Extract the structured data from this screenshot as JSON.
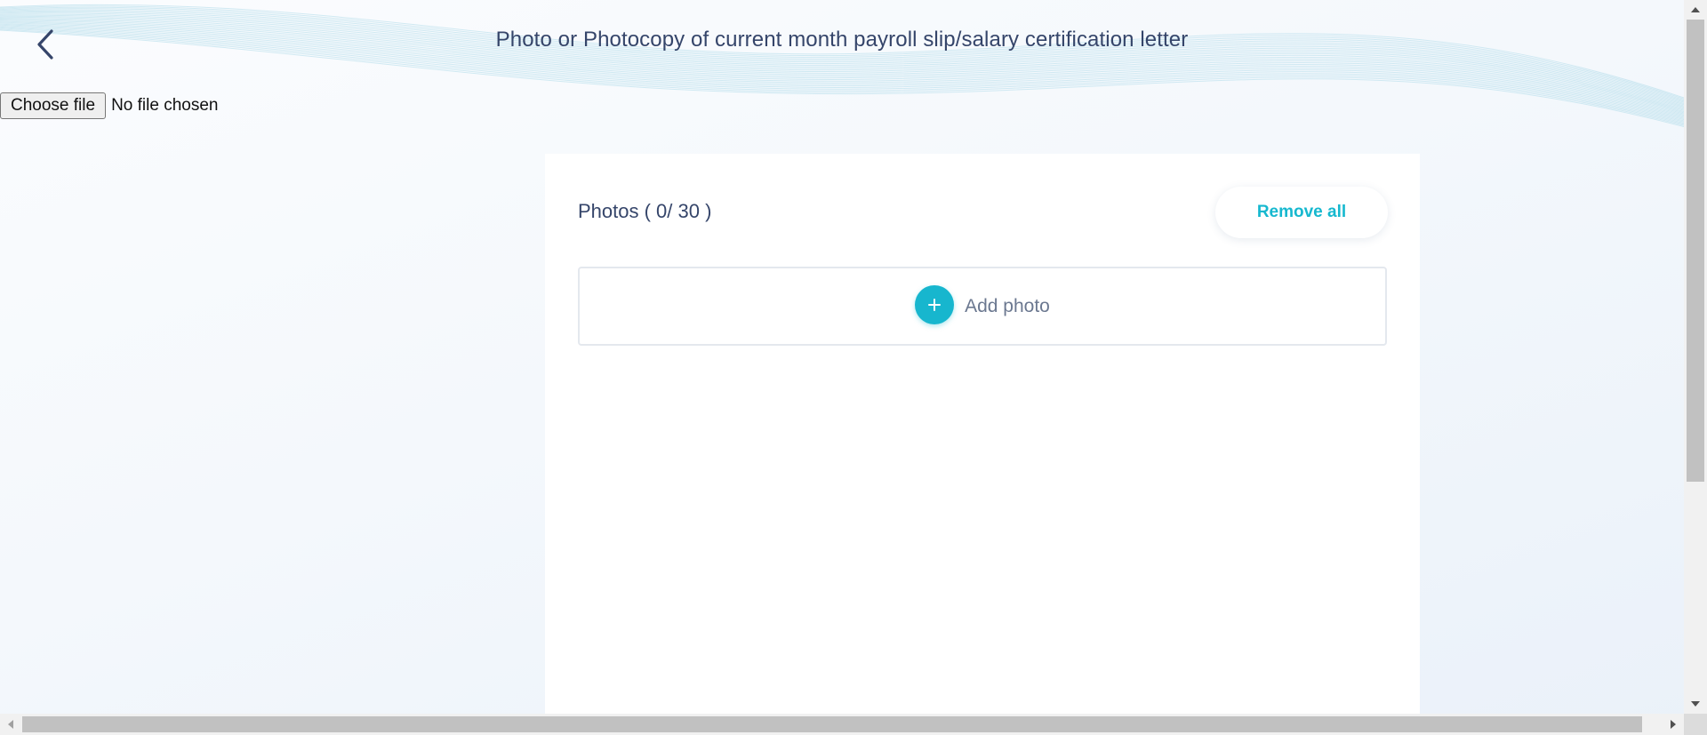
{
  "header": {
    "title": "Photo or Photocopy of current month payroll slip/salary certification letter",
    "back_icon": "chevron-left-icon"
  },
  "file_input": {
    "button_label": "Choose file",
    "status": "No file chosen"
  },
  "photos": {
    "label": "Photos ( 0/ 30 )",
    "remove_all_label": "Remove all",
    "add_photo_label": "Add photo",
    "add_icon": "plus-icon"
  },
  "colors": {
    "accent": "#17b6ce",
    "title_text": "#35456a",
    "muted_text": "#6b7890"
  }
}
